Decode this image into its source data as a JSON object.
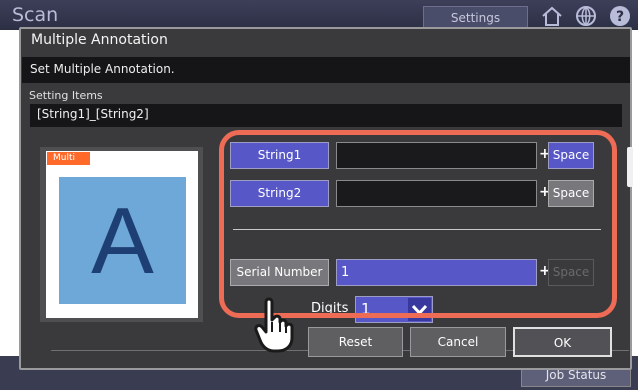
{
  "background": {
    "app_title": "Scan",
    "settings_tab": "Settings",
    "job_status": "Job Status"
  },
  "modal": {
    "title": "Multiple Annotation",
    "subtitle": "Set Multiple Annotation.",
    "setting_items_label": "Setting Items",
    "setting_items_value": "[String1]_[String2]"
  },
  "preview": {
    "badge": "Multi",
    "letter": "A"
  },
  "rows": [
    {
      "button": "String1",
      "value": "",
      "plus": "+",
      "space": "Space"
    },
    {
      "button": "String2",
      "value": "",
      "plus": "+",
      "space": "Space"
    },
    {
      "button": "Serial Number",
      "value": "1",
      "plus": "+",
      "space": "Space"
    }
  ],
  "digits": {
    "label": "Digits",
    "value": "1"
  },
  "footer": {
    "reset": "Reset",
    "cancel": "Cancel",
    "ok": "OK"
  },
  "colors": {
    "accent": "#5757c7",
    "highlight": "#ee6b55",
    "badge": "#ff6a2a"
  }
}
